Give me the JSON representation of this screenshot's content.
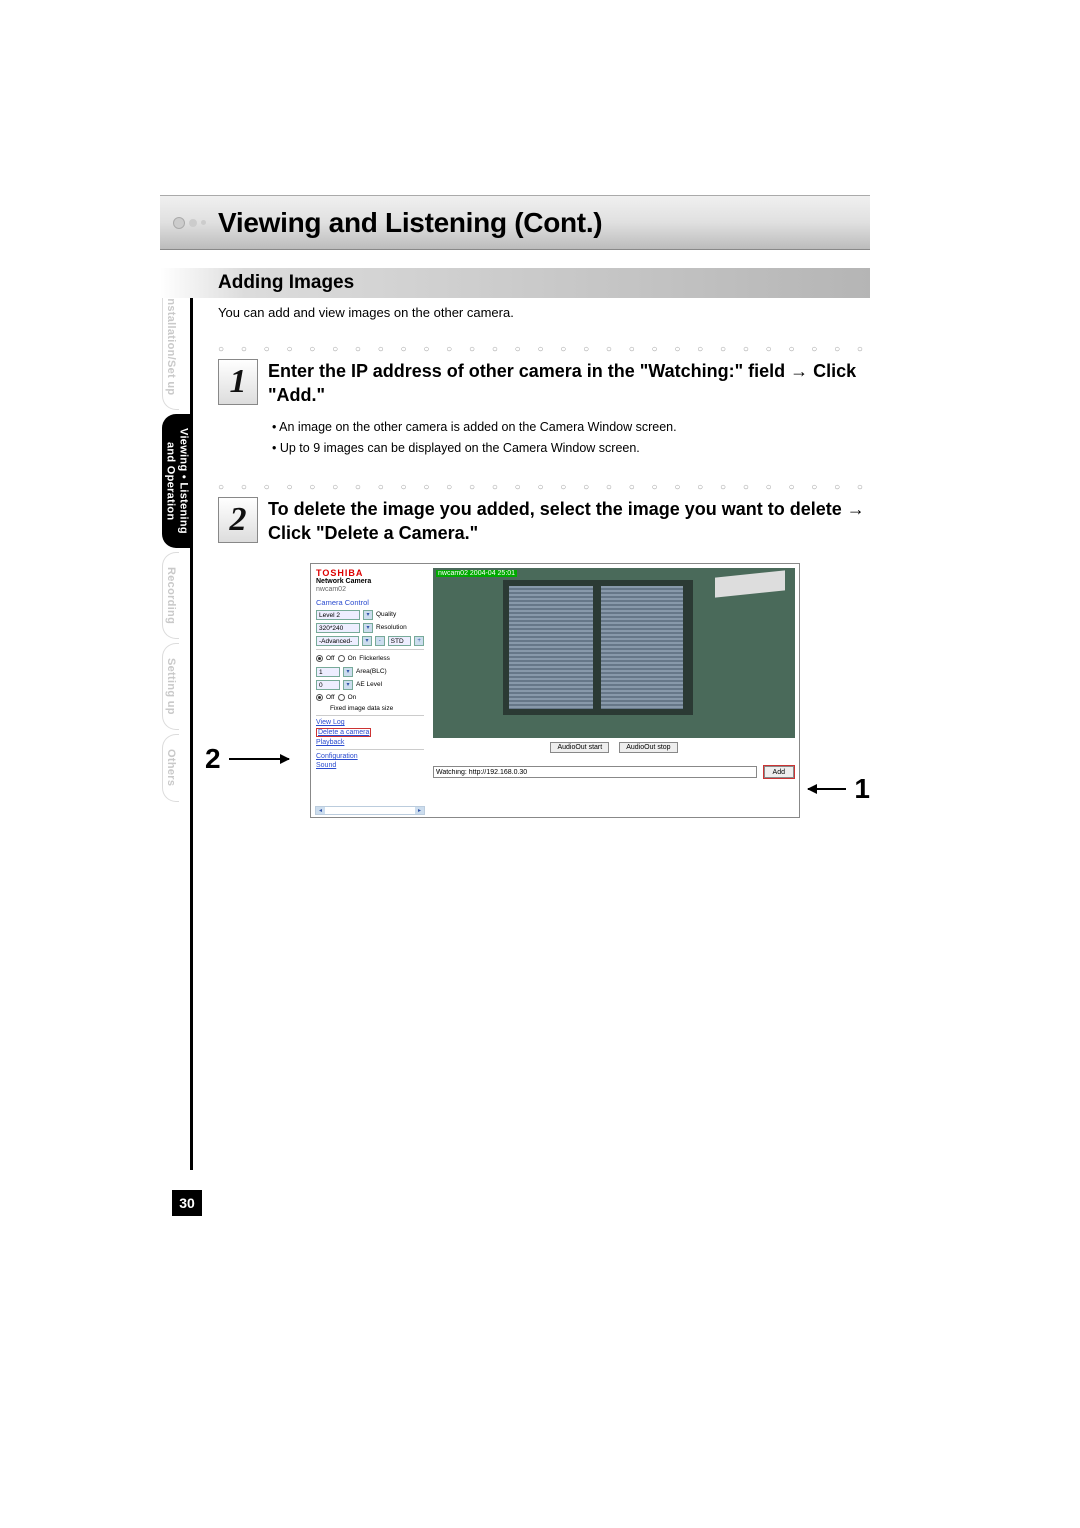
{
  "page_number": "30",
  "title": "Viewing and Listening (Cont.)",
  "side_tabs": {
    "installation": "Installation/Set up",
    "viewing_l1": "Viewing • Listening",
    "viewing_l2": "and Operation",
    "recording": "Recording",
    "setting": "Setting up",
    "others": "Others"
  },
  "section": {
    "heading": "Adding Images",
    "intro": "You can add and view images on the other camera."
  },
  "step1": {
    "num": "1",
    "text": "Enter the IP address of other camera in the \"Watching:\" field → Click \"Add.\"",
    "bullets": [
      "An image on the other camera is added on the Camera Window screen.",
      "Up to 9 images can be displayed on the Camera Window screen."
    ]
  },
  "step2": {
    "num": "2",
    "text": "To delete the image you added, select the image you want to delete → Click \"Delete a Camera.\""
  },
  "callouts": {
    "left": "2",
    "right": "1"
  },
  "screenshot": {
    "brand": "TOSHIBA",
    "brand_sub": "Network Camera",
    "cam_name": "nwcam02",
    "camera_control": "Camera Control",
    "quality_sel": "Level 2",
    "quality_lbl": "Quality",
    "res_sel": "320*240",
    "res_lbl": "Resolution",
    "adv_sel": "-Advanced-",
    "std_sel": "STD",
    "flicker_off": "Off",
    "flicker_on": "On",
    "flicker_lbl": "Flickerless",
    "area_sel": "1",
    "area_lbl": "Area(BLC)",
    "ae_sel": "0",
    "ae_lbl": "AE Level",
    "fixed_lbl": "Fixed image data size",
    "links": {
      "viewlog": "View Log",
      "delete": "Delete a camera",
      "playback": "Playback",
      "config": "Configuration",
      "sound": "Sound"
    },
    "overlay": "nwcam02  2004-04   25:01",
    "audio_start": "AudioOut start",
    "audio_stop": "AudioOut stop",
    "watching_value": "Watching: http://192.168.0.30",
    "add_btn": "Add"
  }
}
